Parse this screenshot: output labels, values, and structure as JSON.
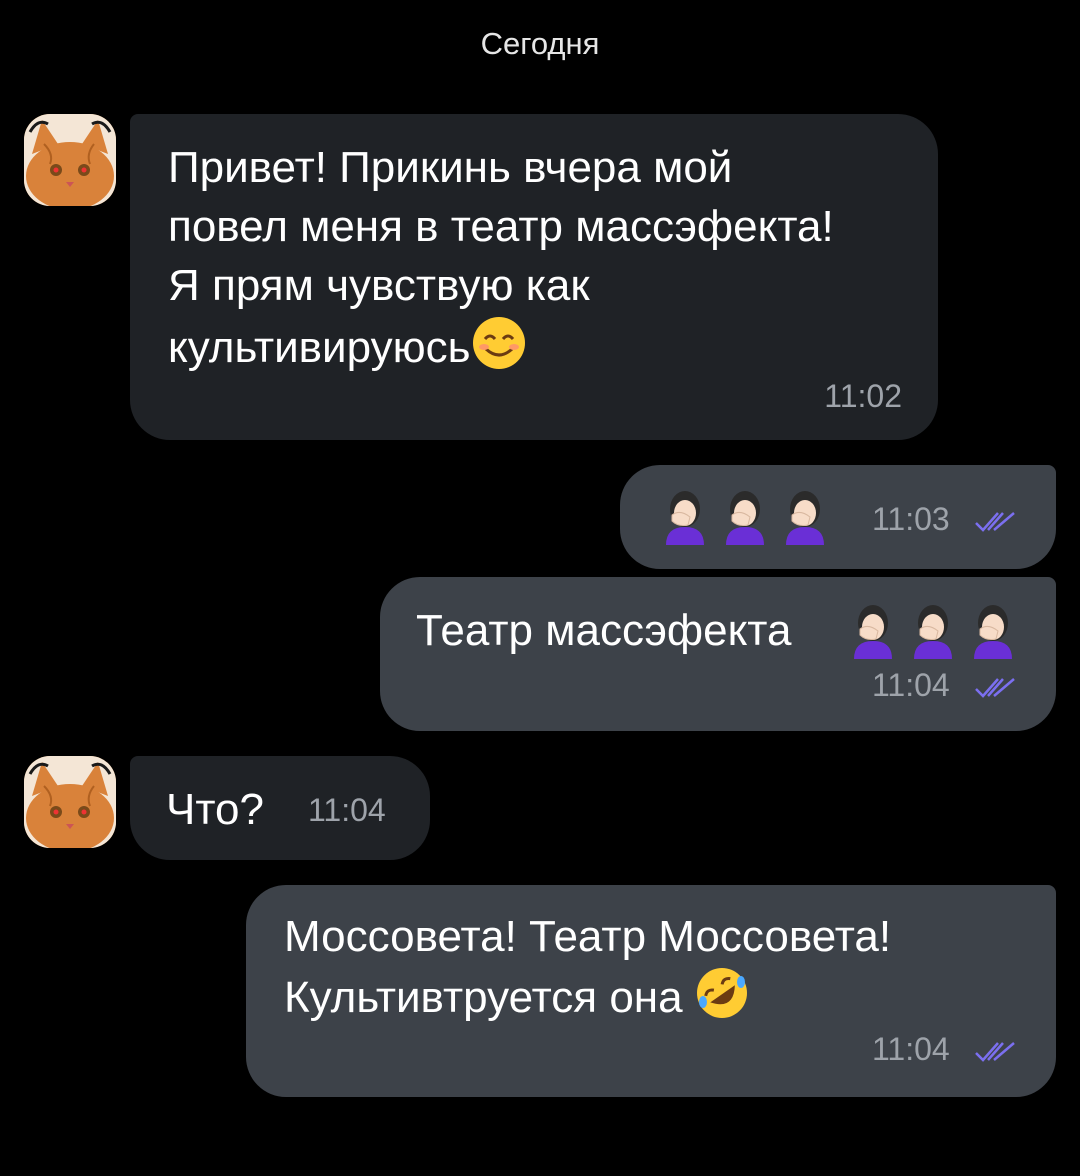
{
  "date_separator": "Сегодня",
  "messages": [
    {
      "direction": "incoming",
      "lines": [
        "Привет! Прикинь вчера мой",
        "повел меня в театр массэфекта!",
        "Я прям чувствую как",
        "культивируюсь"
      ],
      "emoji": "smiling-face-icon",
      "time": "11:02"
    },
    {
      "direction": "outgoing",
      "text": "",
      "emoji": "woman-facepalming-icon",
      "emoji_count": 3,
      "time": "11:03",
      "read": true
    },
    {
      "direction": "outgoing",
      "text": "Театр массэфекта",
      "emoji": "woman-facepalming-icon",
      "emoji_count": 3,
      "time": "11:04",
      "read": true
    },
    {
      "direction": "incoming",
      "text": "Что?",
      "time": "11:04"
    },
    {
      "direction": "outgoing",
      "lines": [
        "Моссовета! Театр Моссовета!",
        "Культивтруется она"
      ],
      "emoji": "rolling-laughing-icon",
      "time": "11:04",
      "read": true
    }
  ],
  "colors": {
    "background": "#000000",
    "incoming_bubble": "#1f2226",
    "outgoing_bubble": "#3d4249",
    "time_text": "#9ea3aa",
    "read_check": "#7b6ff0"
  }
}
